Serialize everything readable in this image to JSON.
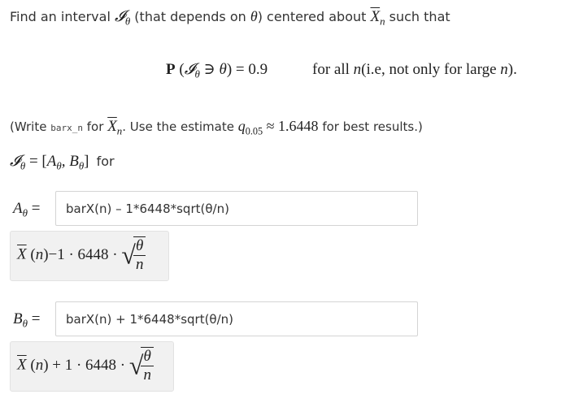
{
  "question": {
    "intro_text": "Find an interval",
    "intro_paren": "(that depends on",
    "intro_theta": "θ",
    "intro_rest": ") centered about",
    "intro_end": "such that",
    "prob_statement": "P (𝓘θ ∋ θ) = 0.9",
    "for_all": "for all",
    "for_all_rest": "(i.e, not only for large",
    "hint_open": "(Write",
    "hint_code": "barx_n",
    "hint_for": "for",
    "hint_use": ". Use the estimate",
    "hint_q": "q",
    "hint_q_sub": "0.05",
    "hint_value": "≈ 1.6448",
    "hint_close": "for best results.)",
    "interval_def": "𝓘θ = [Aθ, Bθ]",
    "interval_for": "for"
  },
  "answers": {
    "a_label": "Aθ =",
    "a_input_value": "barX(n) – 1*6448*sqrt(θ/n)",
    "a_preview_left": "X (n)−1 · 6448 ·",
    "b_label": "Bθ =",
    "b_input_value": "barX(n) + 1*6448*sqrt(θ/n)",
    "b_preview_left": "X (n) + 1 · 6448 ·",
    "frac_num": "θ",
    "frac_den": "n"
  }
}
